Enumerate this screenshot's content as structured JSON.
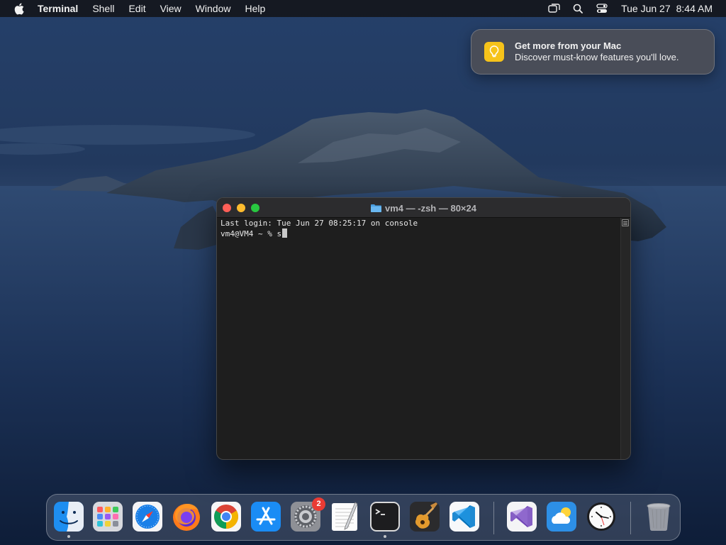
{
  "menubar": {
    "apple_icon": "apple-logo-icon",
    "app_name": "Terminal",
    "menus": [
      "Shell",
      "Edit",
      "View",
      "Window",
      "Help"
    ],
    "status_icons": [
      "screen-mirroring-icon",
      "spotlight-search-icon",
      "control-center-icon"
    ],
    "date": "Tue Jun 27",
    "time": "8:44 AM"
  },
  "notification": {
    "icon": "tips-lightbulb-icon",
    "accent": "#f6c31a",
    "title": "Get more from your Mac",
    "body": "Discover must-know features you'll love."
  },
  "terminal": {
    "title": "vm4 — -zsh — 80×24",
    "folder_icon": "folder-icon",
    "lines": [
      "Last login: Tue Jun 27 08:25:17 on console",
      "vm4@VM4 ~ % s"
    ]
  },
  "dock": {
    "apps": [
      {
        "name": "Finder",
        "icon": "finder-icon",
        "running": true
      },
      {
        "name": "Launchpad",
        "icon": "launchpad-icon",
        "running": false
      },
      {
        "name": "Safari",
        "icon": "safari-icon",
        "running": false
      },
      {
        "name": "Firefox",
        "icon": "firefox-icon",
        "running": false
      },
      {
        "name": "Google Chrome",
        "icon": "chrome-icon",
        "running": false
      },
      {
        "name": "App Store",
        "icon": "app-store-icon",
        "running": false
      },
      {
        "name": "System Settings",
        "icon": "system-settings-icon",
        "running": false,
        "badge": "2"
      },
      {
        "name": "TextEdit",
        "icon": "textedit-icon",
        "running": false
      },
      {
        "name": "Terminal",
        "icon": "terminal-icon",
        "running": true
      },
      {
        "name": "GarageBand",
        "icon": "garageband-icon",
        "running": false
      },
      {
        "name": "Visual Studio Code",
        "icon": "vscode-icon",
        "running": false
      },
      {
        "name": "Visual Studio",
        "icon": "visual-studio-icon",
        "running": false
      },
      {
        "name": "Weather",
        "icon": "weather-icon",
        "running": false
      },
      {
        "name": "Clock",
        "icon": "clock-icon",
        "running": false
      },
      {
        "name": "Trash",
        "icon": "trash-icon",
        "running": false
      }
    ]
  }
}
